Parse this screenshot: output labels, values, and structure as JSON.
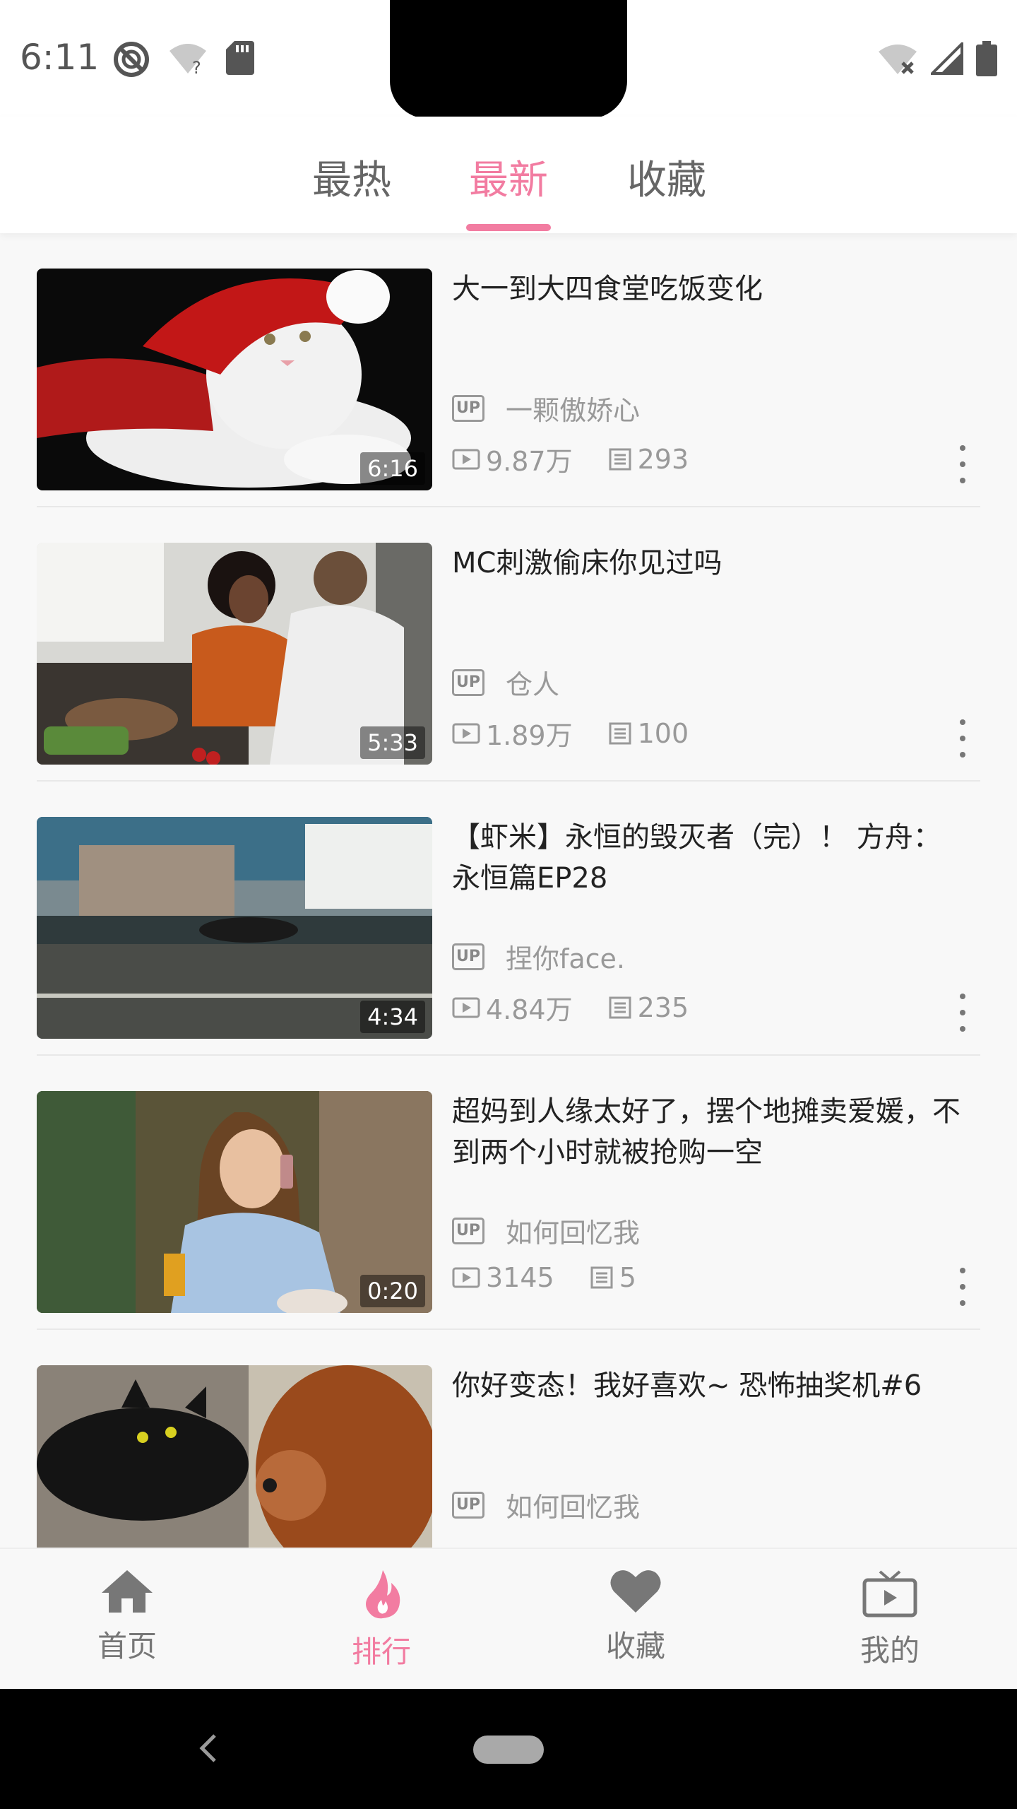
{
  "status_bar": {
    "time": "6:11",
    "left_icons": [
      "do-not-disturb-icon",
      "wifi-question-icon",
      "sd-card-icon"
    ],
    "right_icons": [
      "wifi-off-icon",
      "signal-icon",
      "battery-icon"
    ]
  },
  "tabs": [
    {
      "label": "最热",
      "active": false
    },
    {
      "label": "最新",
      "active": true
    },
    {
      "label": "收藏",
      "active": false
    }
  ],
  "videos": [
    {
      "title": "大一到大四食堂吃饭变化",
      "duration": "6:16",
      "uploader": "一颗傲娇心",
      "views": "9.87万",
      "danmaku": "293",
      "thumb": "white cat in santa hat"
    },
    {
      "title": "MC刺激偷床你见过吗",
      "duration": "5:33",
      "uploader": "仓人",
      "views": "1.89万",
      "danmaku": "100",
      "thumb": "couple cooking in kitchen"
    },
    {
      "title": "【虾米】永恒的毁灭者（完）！ 方舟：永恒篇EP28",
      "duration": "4:34",
      "uploader": "捏你face.",
      "views": "4.84万",
      "danmaku": "235",
      "thumb": "motion blurred street"
    },
    {
      "title": "超妈到人缘太好了，摆个地摊卖爱媛，不到两个小时就被抢购一空",
      "duration": "0:20",
      "uploader": "如何回忆我",
      "views": "3145",
      "danmaku": "5",
      "thumb": "woman on phone in cafe"
    },
    {
      "title": "你好变态！我好喜欢~ 恐怖抽奖机#6",
      "duration": "",
      "uploader": "如何回忆我",
      "views": "",
      "danmaku": "",
      "thumb": "black cat and spaniel"
    }
  ],
  "labels": {
    "up_badge": "UP"
  },
  "bottom_nav": [
    {
      "label": "首页",
      "icon": "home-icon",
      "active": false
    },
    {
      "label": "排行",
      "icon": "flame-icon",
      "active": true
    },
    {
      "label": "收藏",
      "icon": "heart-icon",
      "active": false
    },
    {
      "label": "我的",
      "icon": "tv-icon",
      "active": false
    }
  ],
  "colors": {
    "accent": "#f27ca1",
    "text": "#222222",
    "muted": "#999999",
    "background": "#f8f8f8"
  }
}
